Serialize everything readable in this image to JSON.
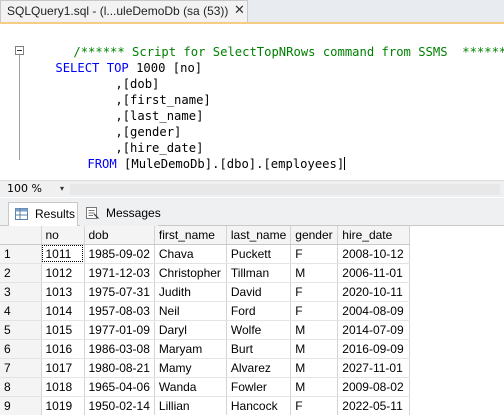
{
  "tab": {
    "title": "SQLQuery1.sql - (l...uleDemoDb (sa (53))",
    "close_symbol": "✕"
  },
  "editor": {
    "comment": "/****** Script for SelectTopNRows command from SSMS  ******/",
    "select_kw": "SELECT",
    "top_kw": "TOP",
    "top_rest": " 1000 [no]",
    "columns": [
      ",[dob]",
      ",[first_name]",
      ",[last_name]",
      ",[gender]",
      ",[hire_date]"
    ],
    "from_kw": "FROM",
    "from_table": " [MuleDemoDb].[dbo].[employees]"
  },
  "zoom": {
    "value": "100 %",
    "arrow": "▾"
  },
  "results_tabs": {
    "results": "Results",
    "messages": "Messages"
  },
  "grid": {
    "headers": [
      "no",
      "dob",
      "first_name",
      "last_name",
      "gender",
      "hire_date"
    ],
    "rows": [
      {
        "n": "1",
        "cells": [
          "1011",
          "1985-09-02",
          "Chava",
          "Puckett",
          "F",
          "2008-10-12"
        ]
      },
      {
        "n": "2",
        "cells": [
          "1012",
          "1971-12-03",
          "Christopher",
          "Tillman",
          "M",
          "2006-11-01"
        ]
      },
      {
        "n": "3",
        "cells": [
          "1013",
          "1975-07-31",
          "Judith",
          "David",
          "F",
          "2020-10-11"
        ]
      },
      {
        "n": "4",
        "cells": [
          "1014",
          "1957-08-03",
          "Neil",
          "Ford",
          "F",
          "2004-08-09"
        ]
      },
      {
        "n": "5",
        "cells": [
          "1015",
          "1977-01-09",
          "Daryl",
          "Wolfe",
          "M",
          "2014-07-09"
        ]
      },
      {
        "n": "6",
        "cells": [
          "1016",
          "1986-03-08",
          "Maryam",
          "Burt",
          "M",
          "2016-09-09"
        ]
      },
      {
        "n": "7",
        "cells": [
          "1017",
          "1980-08-21",
          "Mamy",
          "Alvarez",
          "M",
          "2027-11-01"
        ]
      },
      {
        "n": "8",
        "cells": [
          "1018",
          "1965-04-06",
          "Wanda",
          "Fowler",
          "M",
          "2009-08-02"
        ]
      },
      {
        "n": "9",
        "cells": [
          "1019",
          "1950-02-14",
          "Lillian",
          "Hancock",
          "F",
          "2022-05-11"
        ]
      }
    ]
  },
  "colors": {
    "keyword": "#0000ff",
    "comment": "#008000",
    "punctuation": "#808080",
    "tab_accent": "#f5cc84"
  }
}
